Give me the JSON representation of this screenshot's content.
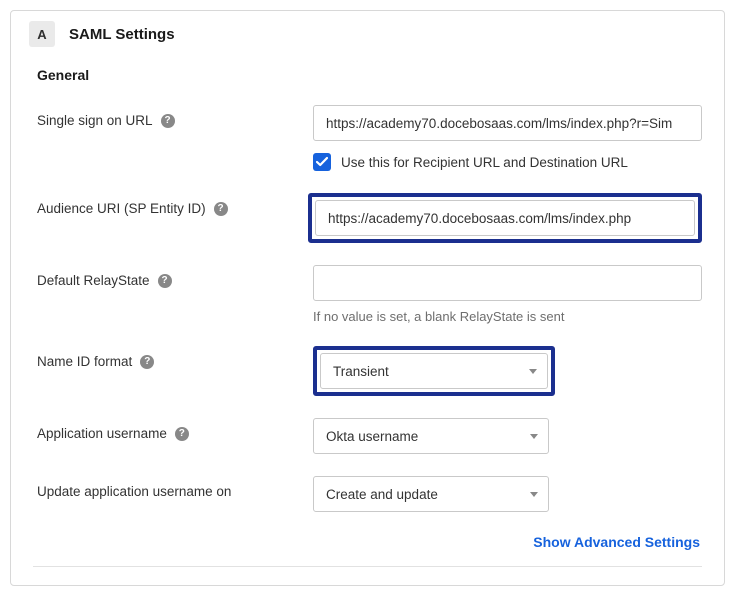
{
  "step_badge": "A",
  "panel_title": "SAML Settings",
  "section_title": "General",
  "fields": {
    "sso_url": {
      "label": "Single sign on URL",
      "value": "https://academy70.docebosaas.com/lms/index.php?r=Sim",
      "checkbox_label": "Use this for Recipient URL and Destination URL"
    },
    "audience_uri": {
      "label": "Audience URI (SP Entity ID)",
      "value": "https://academy70.docebosaas.com/lms/index.php"
    },
    "relay_state": {
      "label": "Default RelayState",
      "value": "",
      "helper": "If no value is set, a blank RelayState is sent"
    },
    "name_id": {
      "label": "Name ID format",
      "value": "Transient"
    },
    "app_username": {
      "label": "Application username",
      "value": "Okta username"
    },
    "update_on": {
      "label": "Update application username on",
      "value": "Create and update"
    }
  },
  "advanced_link": "Show Advanced Settings"
}
